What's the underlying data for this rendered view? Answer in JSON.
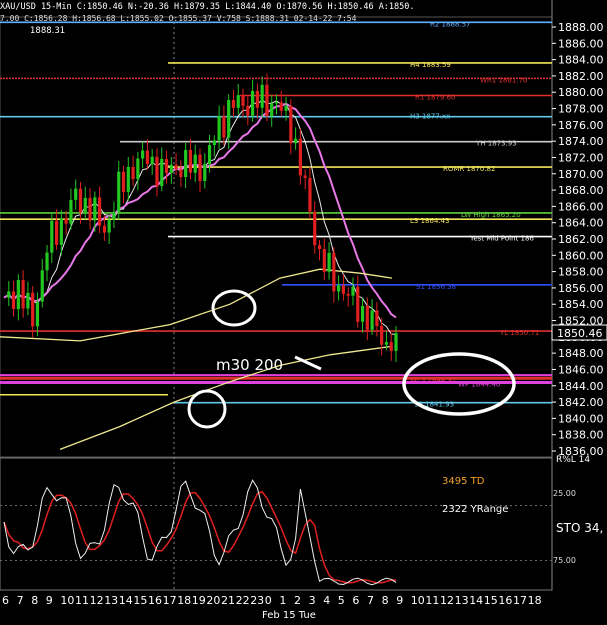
{
  "header": {
    "text": "XAU/USD 15-Min C:1850.46 N:-20.36 H:1879.35 L:1844.40 O:1870.56 H:1850.46 A:1850.",
    "sub": "7.00 C:1856.28 H:1856.68 L:1855.02 O:1855.37 V:758 S:1888.31 02-14-22 7:54"
  },
  "top_label": "1888.31",
  "price_axis": {
    "min": 1836,
    "max": 1889,
    "ticks": [
      "1888.00",
      "1886.00",
      "1884.00",
      "1882.00",
      "1880.00",
      "1878.00",
      "1876.00",
      "1874.00",
      "1872.00",
      "1870.00",
      "1868.00",
      "1866.00",
      "1864.00",
      "1862.00",
      "1860.00",
      "1858.00",
      "1856.00",
      "1854.00",
      "1852.00",
      "1850.00",
      "1848.00",
      "1846.00",
      "1844.00",
      "1842.00",
      "1840.00",
      "1838.00",
      "1836.00"
    ],
    "last_price": "1850.46"
  },
  "levels": [
    {
      "label": "R2 1888.57",
      "value": 1888.57,
      "color": "#5fb0ff"
    },
    {
      "label": "H4 1883.59",
      "value": 1883.59,
      "color": "#f3e65a"
    },
    {
      "label": "WR1 1881.70",
      "value": 1881.7,
      "color": "#e03030"
    },
    {
      "label": "R1 1879.60",
      "value": 1879.6,
      "color": "#e03030"
    },
    {
      "label": "H3 1877.xx",
      "value": 1877.0,
      "color": "#60c8e8"
    },
    {
      "label": "YH 1873.93",
      "value": 1873.93,
      "color": "#cccccc"
    },
    {
      "label": "ROMR 1870.82",
      "value": 1870.82,
      "color": "#f3e65a"
    },
    {
      "label": "LW High 1865.20",
      "value": 1865.2,
      "color": "#60d040"
    },
    {
      "label": "L3 1864.43",
      "value": 1864.43,
      "color": "#f3e65a"
    },
    {
      "label": "Yest Mid Point 186",
      "value": 1862.3,
      "color": "#ffffff"
    },
    {
      "label": "S1 1856.38",
      "value": 1856.38,
      "color": "#3050ff"
    },
    {
      "label": "YL 1850.71",
      "value": 1850.71,
      "color": "#e03030"
    },
    {
      "label": "WL3 1844.92",
      "value": 1844.92,
      "color": "#e03030"
    },
    {
      "label": "WP 1844.40",
      "value": 1844.4,
      "color": "#e040e0"
    },
    {
      "label": "S2 1841.93",
      "value": 1841.93,
      "color": "#60c8e8"
    }
  ],
  "annotations": {
    "ma_label": "m30 200",
    "td_label": "3495 TD",
    "yrange_label": "2322 YRange",
    "sto_label": "STO 34,",
    "osc_top": "25.00",
    "osc_bot": "75.00",
    "osc_title": "R%L 14"
  },
  "time_axis": {
    "labels": [
      "6",
      "7",
      "8",
      "9",
      "10",
      "11",
      "12",
      "13",
      "14",
      "15",
      "16",
      "17",
      "18",
      "19",
      "20",
      "21",
      "22",
      "23",
      "0",
      "1",
      "2",
      "3",
      "4",
      "5",
      "6",
      "7",
      "8",
      "9",
      "10",
      "11",
      "12",
      "13",
      "14",
      "15",
      "16",
      "17",
      "18"
    ],
    "date_label": "Feb 15 Tue"
  },
  "colors": {
    "up": "#22c722",
    "down": "#e02020",
    "ma_white": "#e8e8e8",
    "ma_pink": "#e878e8",
    "ma_yellow": "#f0e890",
    "osc_white": "#f0f0f0",
    "osc_red": "#e02020"
  },
  "chart_data": {
    "type": "line",
    "title": "XAU/USD 15-Min",
    "price_path": [
      [
        0,
        1854
      ],
      [
        3,
        1856
      ],
      [
        6,
        1852
      ],
      [
        9,
        1861
      ],
      [
        12,
        1864
      ],
      [
        15,
        1867
      ],
      [
        18,
        1866
      ],
      [
        21,
        1863
      ],
      [
        24,
        1868
      ],
      [
        27,
        1871
      ],
      [
        30,
        1872
      ],
      [
        33,
        1870
      ],
      [
        36,
        1871
      ],
      [
        39,
        1871
      ],
      [
        42,
        1871
      ],
      [
        45,
        1876
      ],
      [
        48,
        1878.5
      ],
      [
        51,
        1878.7
      ],
      [
        54,
        1879
      ],
      [
        57,
        1878.5
      ],
      [
        60,
        1876
      ],
      [
        63,
        1868
      ],
      [
        66,
        1860
      ],
      [
        69,
        1857
      ],
      [
        72,
        1855
      ],
      [
        75,
        1853
      ],
      [
        78,
        1851
      ],
      [
        80,
        1849
      ],
      [
        82,
        1850.46
      ]
    ],
    "x_range": [
      0,
      84
    ],
    "y_range": [
      1836,
      1889
    ]
  }
}
